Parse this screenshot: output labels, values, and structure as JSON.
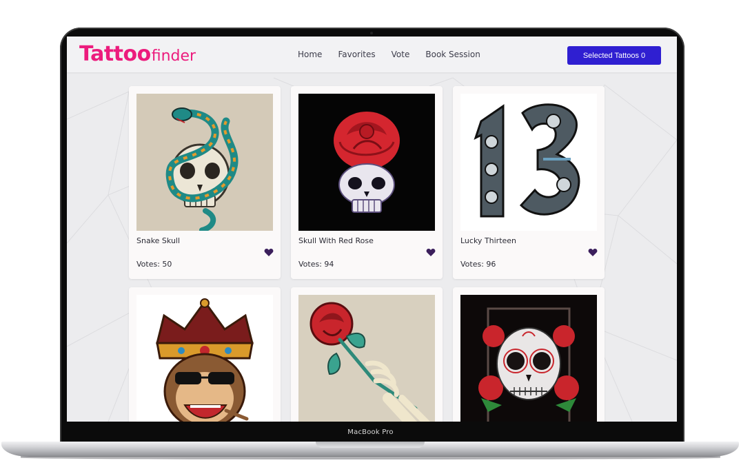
{
  "device": {
    "label": "MacBook Pro"
  },
  "logo": {
    "bold": "Tattoo",
    "light": "finder"
  },
  "nav": {
    "links": [
      "Home",
      "Favorites",
      "Vote",
      "Book Session"
    ]
  },
  "selected_button": {
    "label": "Selected Tattoos 0"
  },
  "cards": [
    {
      "title": "Snake Skull",
      "votes": "Votes: 50",
      "art": "snake-skull-icon"
    },
    {
      "title": "Skull With Red Rose",
      "votes": "Votes: 94",
      "art": "rose-skull-icon"
    },
    {
      "title": "Lucky Thirteen",
      "votes": "Votes: 96",
      "art": "lucky-thirteen-icon"
    },
    {
      "title": "",
      "votes": "",
      "art": "crowned-monkey-icon"
    },
    {
      "title": "",
      "votes": "",
      "art": "skeleton-hand-rose-icon"
    },
    {
      "title": "",
      "votes": "",
      "art": "sugar-skull-icon"
    }
  ],
  "colors": {
    "brand": "#ec1c7d",
    "button": "#2f1fd1",
    "heart": "#3b1f5c"
  }
}
